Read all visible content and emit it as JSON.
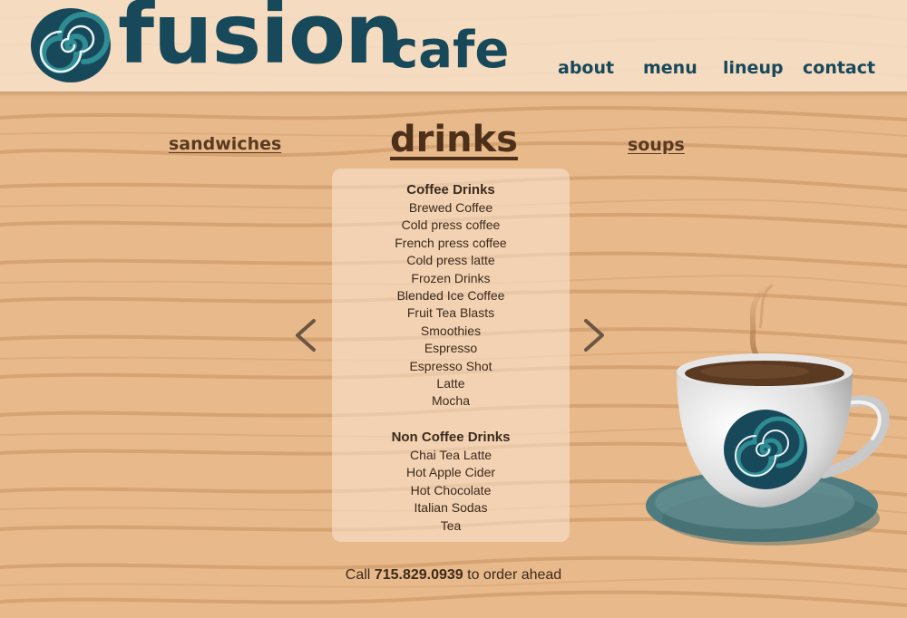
{
  "brand": {
    "name": "fusion",
    "suffix": "cafe"
  },
  "nav": [
    {
      "label": "about"
    },
    {
      "label": "menu"
    },
    {
      "label": "lineup"
    },
    {
      "label": "contact"
    }
  ],
  "categories": {
    "previous": "sandwiches",
    "current": "drinks",
    "next": "soups"
  },
  "menu": {
    "sections": [
      {
        "title": "Coffee Drinks",
        "items": [
          "Brewed Coffee",
          "Cold press coffee",
          "French press coffee",
          "Cold press latte",
          "Frozen Drinks",
          "Blended Ice Coffee",
          "Fruit Tea Blasts",
          "Smoothies",
          "Espresso",
          "Espresso Shot",
          "Latte",
          "Mocha"
        ]
      },
      {
        "title": "Non Coffee Drinks",
        "items": [
          "Chai Tea Latte",
          "Hot Apple Cider",
          "Hot Chocolate",
          "Italian Sodas",
          "Tea"
        ]
      }
    ]
  },
  "footer": {
    "prefix": "Call",
    "phone": "715.829.0939",
    "suffix": "to order ahead"
  },
  "icons": {
    "logo": "spiral-logo-icon",
    "prev": "chevron-left-icon",
    "next": "chevron-right-icon",
    "cup": "coffee-cup-icon"
  },
  "colors": {
    "brand": "#17495b",
    "brand_accent": "#2e8c92",
    "wood": "#e8b98a",
    "header_band": "#f8e4ce",
    "category_text": "#5a3a22"
  }
}
